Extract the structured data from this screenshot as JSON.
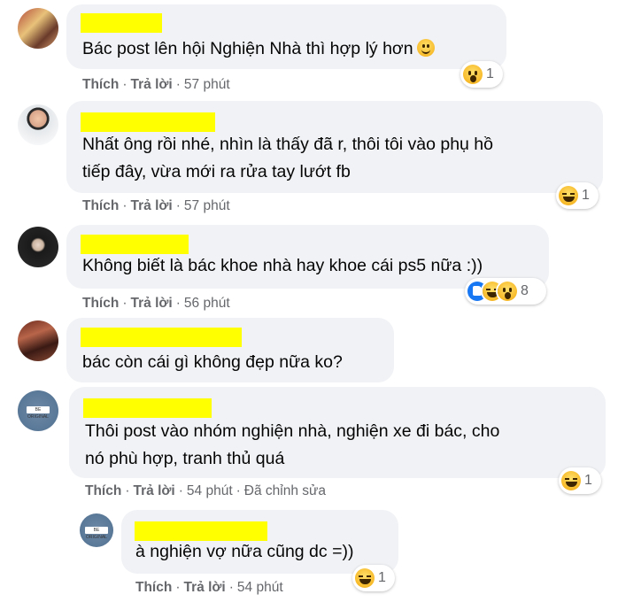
{
  "comments": [
    {
      "text": "Bác post lên hội Nghiện Nhà thì hợp lý hơn",
      "inline_emoji": "slightly-smiling-face-icon",
      "actions": {
        "like": "Thích",
        "reply": "Trả lời",
        "time": "57 phút"
      },
      "reaction_count": "1"
    },
    {
      "text": "Nhất ông rồi nhé, nhìn là thấy đã r, thôi tôi vào phụ hồ\ntiếp đây, vừa mới ra rửa tay lướt fb",
      "actions": {
        "like": "Thích",
        "reply": "Trả lời",
        "time": "57 phút"
      },
      "reaction_count": "1"
    },
    {
      "text": "Không biết là bác khoe nhà hay khoe cái ps5 nữa :))",
      "actions": {
        "like": "Thích",
        "reply": "Trả lời",
        "time": "56 phút"
      },
      "reaction_count": "8"
    },
    {
      "text": "bác còn cái gì không đẹp nữa ko?"
    },
    {
      "text": "Thôi post vào nhóm nghiện nhà, nghiện xe đi bác, cho\nnó phù hợp, tranh thủ quá",
      "avatar_text": "BE ORIGINAL",
      "actions": {
        "like": "Thích",
        "reply": "Trả lời",
        "time": "54 phút",
        "edited": "Đã chỉnh sửa"
      },
      "reaction_count": "1"
    }
  ],
  "reply": {
    "text": "à nghiện vợ nữa cũng dc =))",
    "avatar_text": "BE ORIGINAL",
    "actions": {
      "like": "Thích",
      "reply": "Trả lời",
      "time": "54 phút"
    },
    "reaction_count": "1"
  },
  "colors": {
    "bubble": "#f0f2f5",
    "redaction": "#ffff00",
    "meta": "#65676b",
    "like_blue": "#1877f2"
  }
}
